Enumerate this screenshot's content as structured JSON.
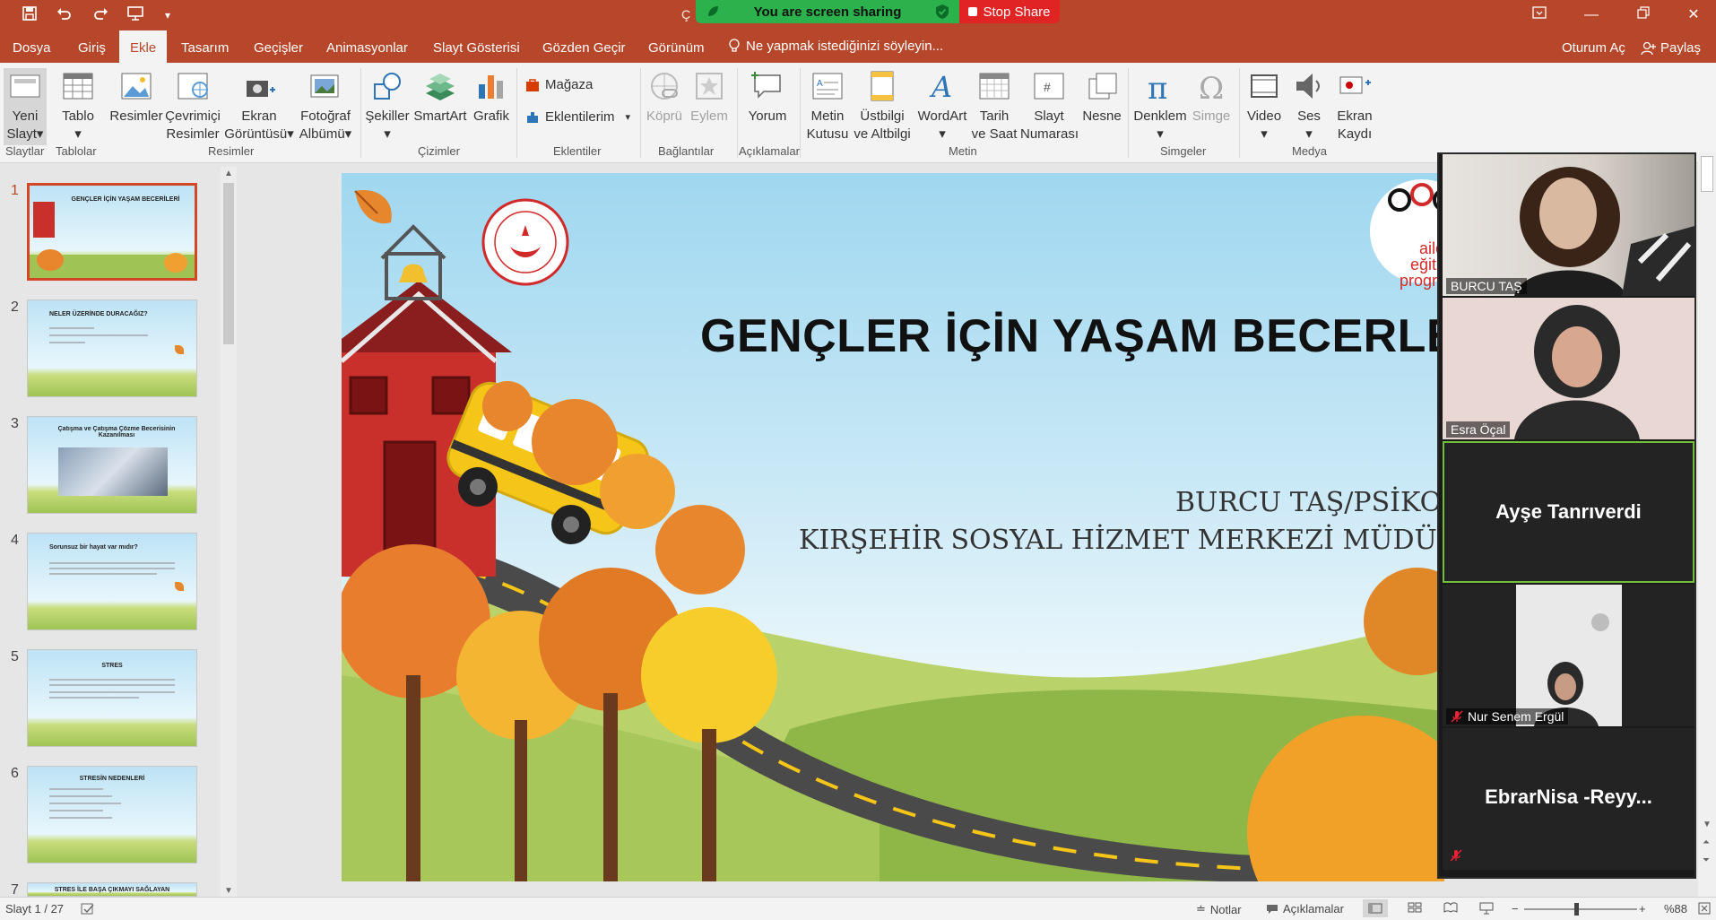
{
  "titlebar": {
    "doc_title": "Ç",
    "sharing_text": "You are screen sharing",
    "stop_share": "Stop Share",
    "quick_access": [
      "save-icon",
      "undo-icon",
      "redo-icon",
      "present-icon",
      "customize-icon"
    ]
  },
  "menu": {
    "tabs": [
      "Dosya",
      "Giriş",
      "Ekle",
      "Tasarım",
      "Geçişler",
      "Animasyonlar",
      "Slayt Gösterisi",
      "Gözden Geçir",
      "Görünüm"
    ],
    "active_tab": "Ekle",
    "tell_me": "Ne yapmak istediğinizi söyleyin...",
    "sign_in": "Oturum Aç",
    "share": "Paylaş"
  },
  "ribbon": {
    "buttons": {
      "new_slide": [
        "Yeni",
        "Slayt"
      ],
      "table": "Tablo",
      "images": "Resimler",
      "online_images": [
        "Çevrimiçi",
        "Resimler"
      ],
      "screenshot": [
        "Ekran",
        "Görüntüsü"
      ],
      "photo_album": [
        "Fotoğraf",
        "Albümü"
      ],
      "shapes": "Şekiller",
      "smartart": "SmartArt",
      "chart": "Grafik",
      "store": "Mağaza",
      "addins": "Eklentilerim",
      "link": "Köprü",
      "action": "Eylem",
      "comment": "Yorum",
      "textbox": [
        "Metin",
        "Kutusu"
      ],
      "header_footer": [
        "Üstbilgi",
        "ve Altbilgi"
      ],
      "wordart": "WordArt",
      "date_time": [
        "Tarih",
        "ve Saat"
      ],
      "slide_number": [
        "Slayt",
        "Numarası"
      ],
      "object": "Nesne",
      "equation": "Denklem",
      "symbol": "Simge",
      "video": "Video",
      "audio": "Ses",
      "screen_recording": [
        "Ekran",
        "Kaydı"
      ]
    },
    "groups": [
      "Slaytlar",
      "Tablolar",
      "Resimler",
      "Çizimler",
      "Eklentiler",
      "Bağlantılar",
      "Açıklamalar",
      "Metin",
      "Simgeler",
      "Medya"
    ]
  },
  "thumbnails": [
    {
      "num": "1",
      "title": "GENÇLER İÇİN YAŞAM BECERİLERİ"
    },
    {
      "num": "2",
      "title": "NELER ÜZERİNDE DURACAĞIZ?"
    },
    {
      "num": "3",
      "title": "Çatışma ve Çatışma Çözme Becerisinin Kazanılması"
    },
    {
      "num": "4",
      "title": "Sorunsuz bir hayat var mıdır?"
    },
    {
      "num": "5",
      "title": "STRES"
    },
    {
      "num": "6",
      "title": "STRESİN NEDENLERİ"
    },
    {
      "num": "7",
      "title": "STRES İLE BAŞA ÇIKMAYI SAĞLAYAN"
    }
  ],
  "slide": {
    "title": "GENÇLER İÇİN YAŞAM BECERLE",
    "subtitle1": "BURCU TAŞ/PSİKOL",
    "subtitle2": "KIRŞEHİR SOSYAL HİZMET MERKEZİ MÜDÜRLÜ",
    "logo_text": [
      "aile",
      "eğitim",
      "programı"
    ]
  },
  "participants": [
    {
      "name": "BURCU TAŞ",
      "video": true
    },
    {
      "name": "Esra Öçal",
      "video": true
    },
    {
      "name": "Ayşe Tanrıverdi",
      "video": false,
      "speaking": true
    },
    {
      "name": "Nur Senem Ergül",
      "video": true,
      "muted": true
    },
    {
      "name": "EbrarNisa -Reyy...",
      "video": false,
      "muted": true
    }
  ],
  "statusbar": {
    "slide_info": "Slayt 1 / 27",
    "notes": "Notlar",
    "comments": "Açıklamalar",
    "zoom": "%88"
  },
  "colors": {
    "accent": "#b7472a",
    "sharing_green": "#2bb24c",
    "stop_red": "#e02424",
    "active_border": "#d24726"
  }
}
